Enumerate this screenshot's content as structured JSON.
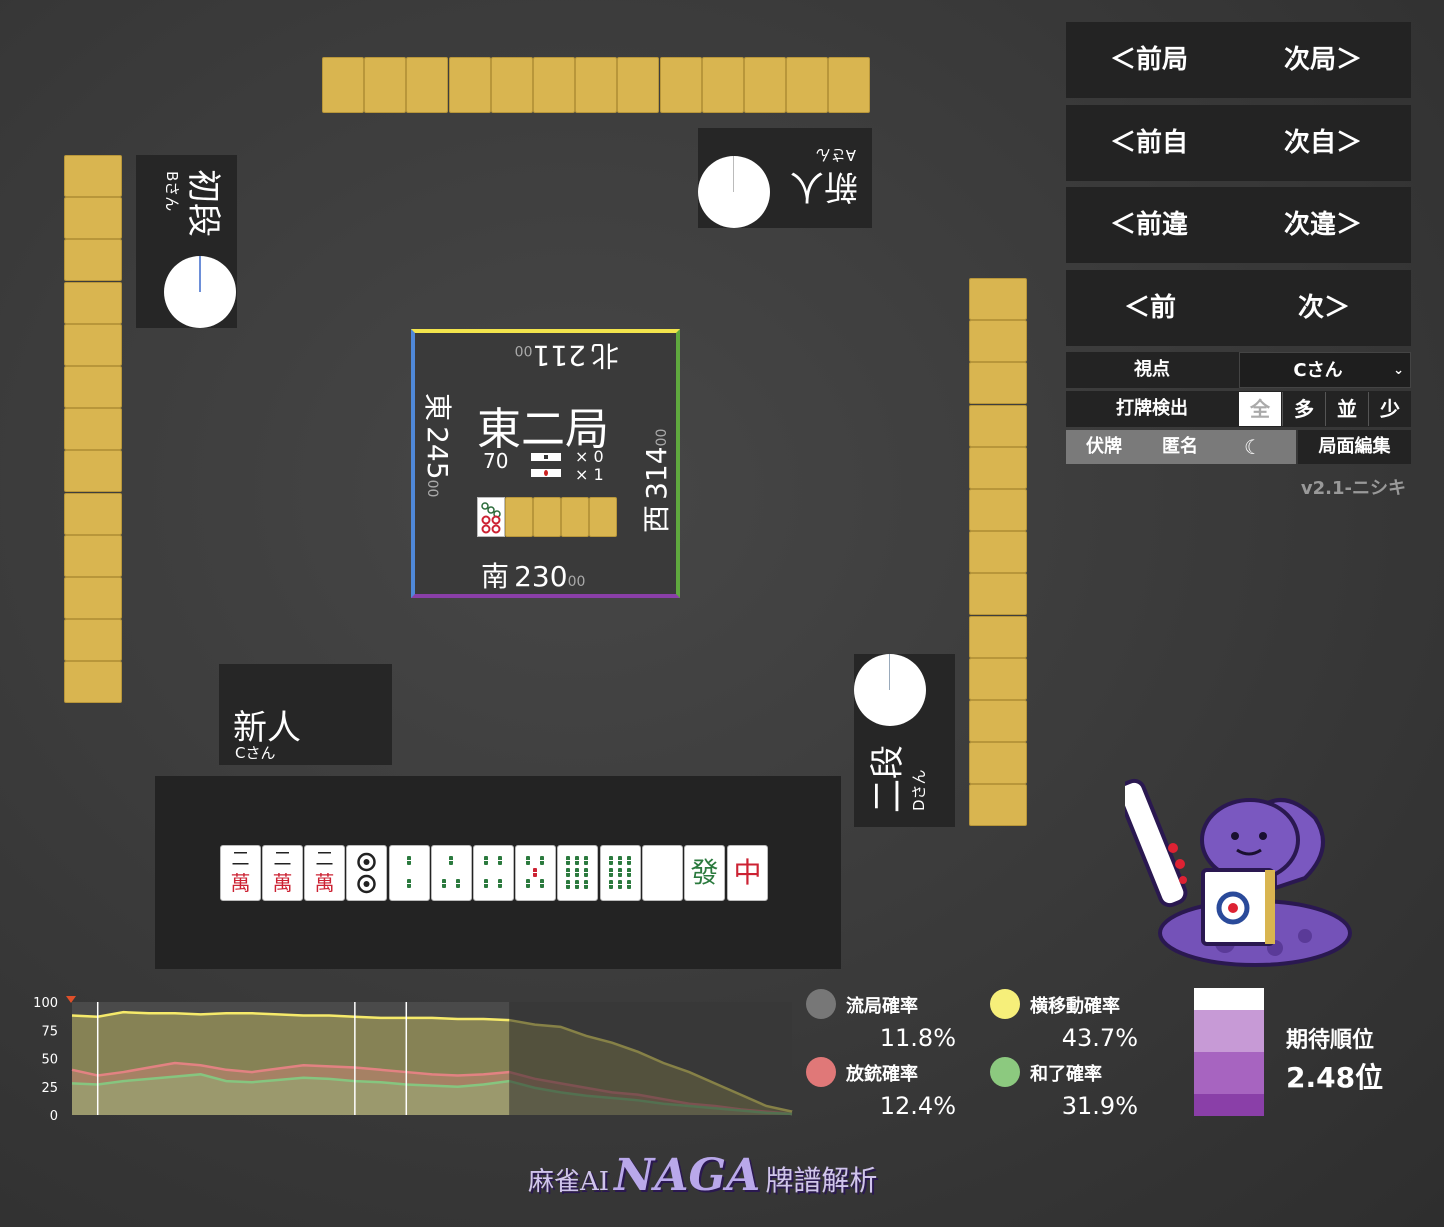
{
  "players": {
    "top": {
      "rank": "新人",
      "name": "Aさん"
    },
    "left": {
      "rank": "初段",
      "name": "Bさん"
    },
    "bottom": {
      "rank": "新人",
      "name": "Cさん"
    },
    "right": {
      "rank": "二段",
      "name": "Dさん"
    }
  },
  "center": {
    "round": "東二局",
    "honba": "70",
    "counters": [
      "× 0",
      "× 1"
    ],
    "scores": {
      "north": {
        "wind": "北",
        "main": "211",
        "sub": "00"
      },
      "east": {
        "wind": "東",
        "main": "245",
        "sub": "00"
      },
      "west": {
        "wind": "西",
        "main": "314",
        "sub": "00"
      },
      "south": {
        "wind": "南",
        "main": "230",
        "sub": "00"
      }
    }
  },
  "nav": {
    "rows": [
      {
        "prev": "＜前局",
        "next": "次局＞"
      },
      {
        "prev": "＜前自",
        "next": "次自＞"
      },
      {
        "prev": "＜前違",
        "next": "次違＞"
      },
      {
        "prev": "＜前",
        "next": "次＞"
      }
    ],
    "viewpoint_label": "視点",
    "viewpoint_value": "Cさん",
    "detect_label": "打牌検出",
    "detect_options": [
      "全",
      "多",
      "並",
      "少"
    ],
    "toggles": [
      "伏牌",
      "匿名"
    ],
    "edit_button": "局面編集",
    "version": "v2.1-ニシキ"
  },
  "hand": [
    {
      "type": "man",
      "top": "二",
      "bottom": "萬"
    },
    {
      "type": "man",
      "top": "二",
      "bottom": "萬"
    },
    {
      "type": "man",
      "top": "二",
      "bottom": "萬"
    },
    {
      "type": "pin2"
    },
    {
      "type": "sou2"
    },
    {
      "type": "sou3"
    },
    {
      "type": "sou4"
    },
    {
      "type": "sou5"
    },
    {
      "type": "sou6"
    },
    {
      "type": "sou6"
    },
    {
      "type": "haku"
    },
    {
      "type": "hatsu",
      "char": "發"
    },
    {
      "type": "chun",
      "char": "中"
    }
  ],
  "chart_data": {
    "type": "area",
    "ylim": [
      0,
      100
    ],
    "yticks": [
      "100",
      "75",
      "50",
      "25",
      "0"
    ],
    "series": [
      {
        "key": "yokoido",
        "color": "#f6ea6a",
        "values": [
          88,
          87,
          91,
          90,
          90,
          89,
          90,
          90,
          89,
          88,
          88,
          87,
          86,
          86,
          86,
          85,
          85,
          84,
          80,
          78,
          70,
          64,
          56,
          46,
          38,
          28,
          18,
          8,
          3
        ]
      },
      {
        "key": "houju",
        "color": "#e28282",
        "values": [
          40,
          35,
          38,
          42,
          46,
          44,
          40,
          38,
          41,
          44,
          43,
          42,
          40,
          38,
          36,
          35,
          36,
          38,
          32,
          28,
          24,
          20,
          18,
          14,
          10,
          8,
          5,
          3,
          1
        ]
      },
      {
        "key": "hora",
        "color": "#86c57f",
        "values": [
          28,
          27,
          30,
          32,
          34,
          36,
          30,
          29,
          31,
          33,
          32,
          30,
          29,
          27,
          26,
          25,
          27,
          30,
          24,
          20,
          17,
          15,
          13,
          10,
          8,
          6,
          4,
          2,
          1
        ]
      }
    ],
    "current_index": 17,
    "markers": [
      1,
      11,
      13
    ]
  },
  "probs": {
    "ryukyoku": {
      "label": "流局確率",
      "value": "11.8%",
      "color": "#777777"
    },
    "houju": {
      "label": "放銃確率",
      "value": "12.4%",
      "color": "#e07878"
    },
    "yokoido": {
      "label": "横移動確率",
      "value": "43.7%",
      "color": "#f6ef7a"
    },
    "hora": {
      "label": "和了確率",
      "value": "31.9%",
      "color": "#8cc97f"
    }
  },
  "rank": {
    "label": "期待順位",
    "value": "2.48位",
    "colors": [
      "#ffffff",
      "#c79ad6",
      "#a764c0",
      "#8a3fa8"
    ]
  },
  "footer": {
    "prefix": "麻雀AI",
    "brand": "NAGA",
    "suffix": "牌譜解析"
  }
}
